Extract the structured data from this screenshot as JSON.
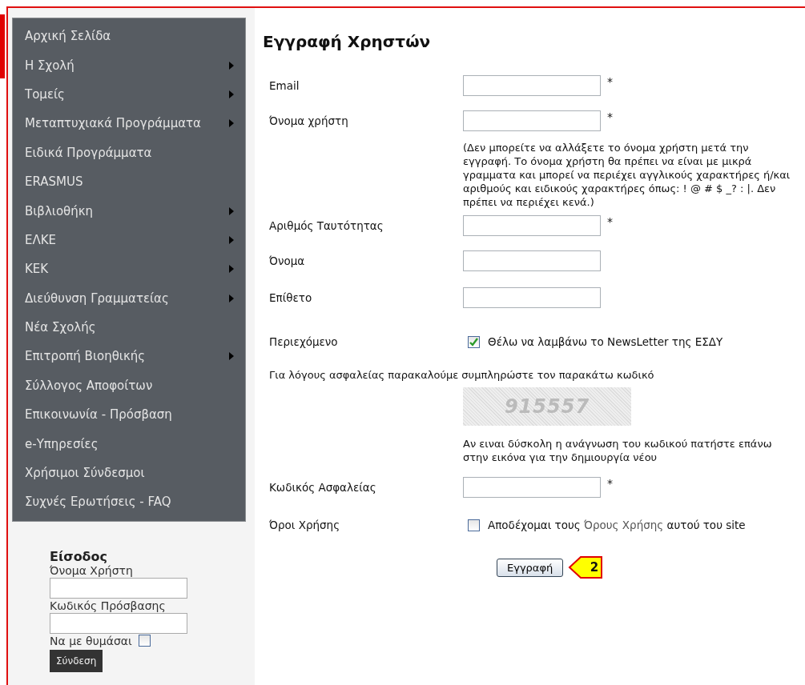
{
  "menu": [
    {
      "label": "Αρχική Σελίδα",
      "submenu": false
    },
    {
      "label": "Η Σχολή",
      "submenu": true
    },
    {
      "label": "Τομείς",
      "submenu": true
    },
    {
      "label": "Μεταπτυχιακά Προγράμματα",
      "submenu": true
    },
    {
      "label": "Ειδικά Προγράμματα",
      "submenu": false
    },
    {
      "label": "ERASMUS",
      "submenu": false
    },
    {
      "label": "Βιβλιοθήκη",
      "submenu": true
    },
    {
      "label": "ΕΛΚΕ",
      "submenu": true
    },
    {
      "label": "ΚΕΚ",
      "submenu": true
    },
    {
      "label": "Διεύθυνση Γραμματείας",
      "submenu": true
    },
    {
      "label": "Νέα Σχολής",
      "submenu": false
    },
    {
      "label": "Επιτροπή Βιοηθικής",
      "submenu": true
    },
    {
      "label": "Σύλλογος Αποφοίτων",
      "submenu": false
    },
    {
      "label": "Επικοινωνία - Πρόσβαση",
      "submenu": false
    },
    {
      "label": "e-Υπηρεσίες",
      "submenu": false
    },
    {
      "label": "Χρήσιμοι Σύνδεσμοι",
      "submenu": false
    },
    {
      "label": "Συχνές Ερωτήσεις - FAQ",
      "submenu": false
    }
  ],
  "login": {
    "title": "Είσοδος",
    "username_label": "Όνομα Χρήστη",
    "password_label": "Κωδικός Πρόσβασης",
    "remember_label": "Να με θυμάσαι",
    "remember_checked": false,
    "button": "Σύνδεση"
  },
  "form": {
    "title": "Εγγραφή Χρηστών",
    "rows": [
      {
        "kind": "field",
        "label": "Email",
        "required": "*"
      },
      {
        "kind": "field",
        "label": "Όνομα χρήστη",
        "required": "*"
      },
      {
        "kind": "note",
        "text": "(Δεν μπορείτε να αλλάξετε το όνομα χρήστη μετά την εγγραφή. Το όνομα χρήστη θα πρέπει να είναι με μικρά γραμματα και μπορεί να περιέχει αγγλικούς χαρακτήρες ή/και αριθμούς και ειδικούς χαρακτήρες όπως: ! @ # $ _? : |. Δεν πρέπει να περιέχει κενά.)"
      },
      {
        "kind": "field",
        "label": "Αριθμός Ταυτότητας",
        "required": "*"
      },
      {
        "kind": "field",
        "label": "Όνομα"
      },
      {
        "kind": "field",
        "label": "Επίθετο"
      },
      {
        "kind": "checkbox",
        "label": "Περιεχόμενο",
        "text": "Θέλω να λαμβάνω το NewsLetter της ΕΣΔΥ",
        "checked": true
      },
      {
        "kind": "text",
        "text": "Για λόγους ασφαλείας παρακαλούμε συμπληρώστε τον παρακάτω κωδικό"
      },
      {
        "kind": "captcha",
        "code": "915557"
      },
      {
        "kind": "note",
        "text": "Αν ειναι δύσκολη η ανάγνωση του κωδικού πατήστε επάνω στην εικόνα για την δημιουργία νέου"
      },
      {
        "kind": "field",
        "label": "Κωδικός Ασφαλείας",
        "required": "*"
      },
      {
        "kind": "terms",
        "label": "Όροι Χρήσης",
        "before": "Αποδέχομαι τους",
        "link": "Όρους Χρήσης",
        "after": "αυτού του site",
        "checked": false
      }
    ],
    "submit": "Εγγραφή",
    "callout": "2"
  }
}
